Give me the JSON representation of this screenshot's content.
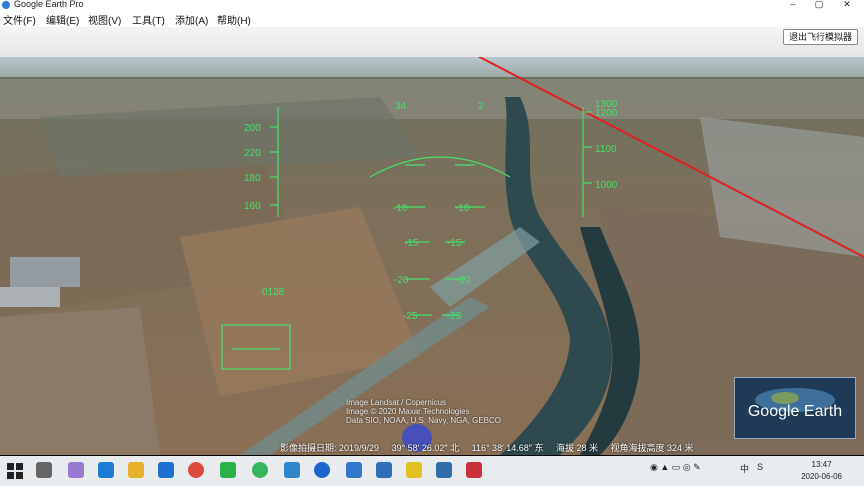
{
  "window": {
    "title": "Google Earth Pro",
    "minimize": "–",
    "restore": "▢",
    "close": "✕"
  },
  "menu": [
    "文件(F)",
    "编辑(E)",
    "视图(V)",
    "工具(T)",
    "添加(A)",
    "帮助(H)"
  ],
  "toolbar": {
    "exit_sim_label": "退出飞行模拟器"
  },
  "hud": {
    "airspeed_ticks": [
      "200",
      "220",
      "180",
      "160"
    ],
    "altitude_ticks": [
      "1300",
      "1200",
      "1100",
      "1000"
    ],
    "pitch_labels": {
      "m10": "-10",
      "m15": "-15",
      "m20": "-20",
      "m25": "-25"
    },
    "heading_ticks": [
      "34",
      "2"
    ],
    "vs_label": "0128"
  },
  "status": {
    "date": "影像拍摄日期: 2019/9/29",
    "lat": "39° 58′ 26.02″ 北",
    "lon": "116° 38′ 14.68″ 东",
    "elev": "海拔 28 米",
    "eye": "视角海拔高度 324 米"
  },
  "copyright": [
    "Image Landsat / Copernicus",
    "Image © 2020 Maxar Technologies",
    "Data SIO, NOAA, U.S. Navy, NGA, GEBCO"
  ],
  "logo": "Google Earth",
  "tray": {
    "lang": "中",
    "clock_time": "13:47",
    "clock_date": "2020-06-06"
  },
  "colors": {
    "hud": "#46e06a",
    "path": "#e02020"
  }
}
